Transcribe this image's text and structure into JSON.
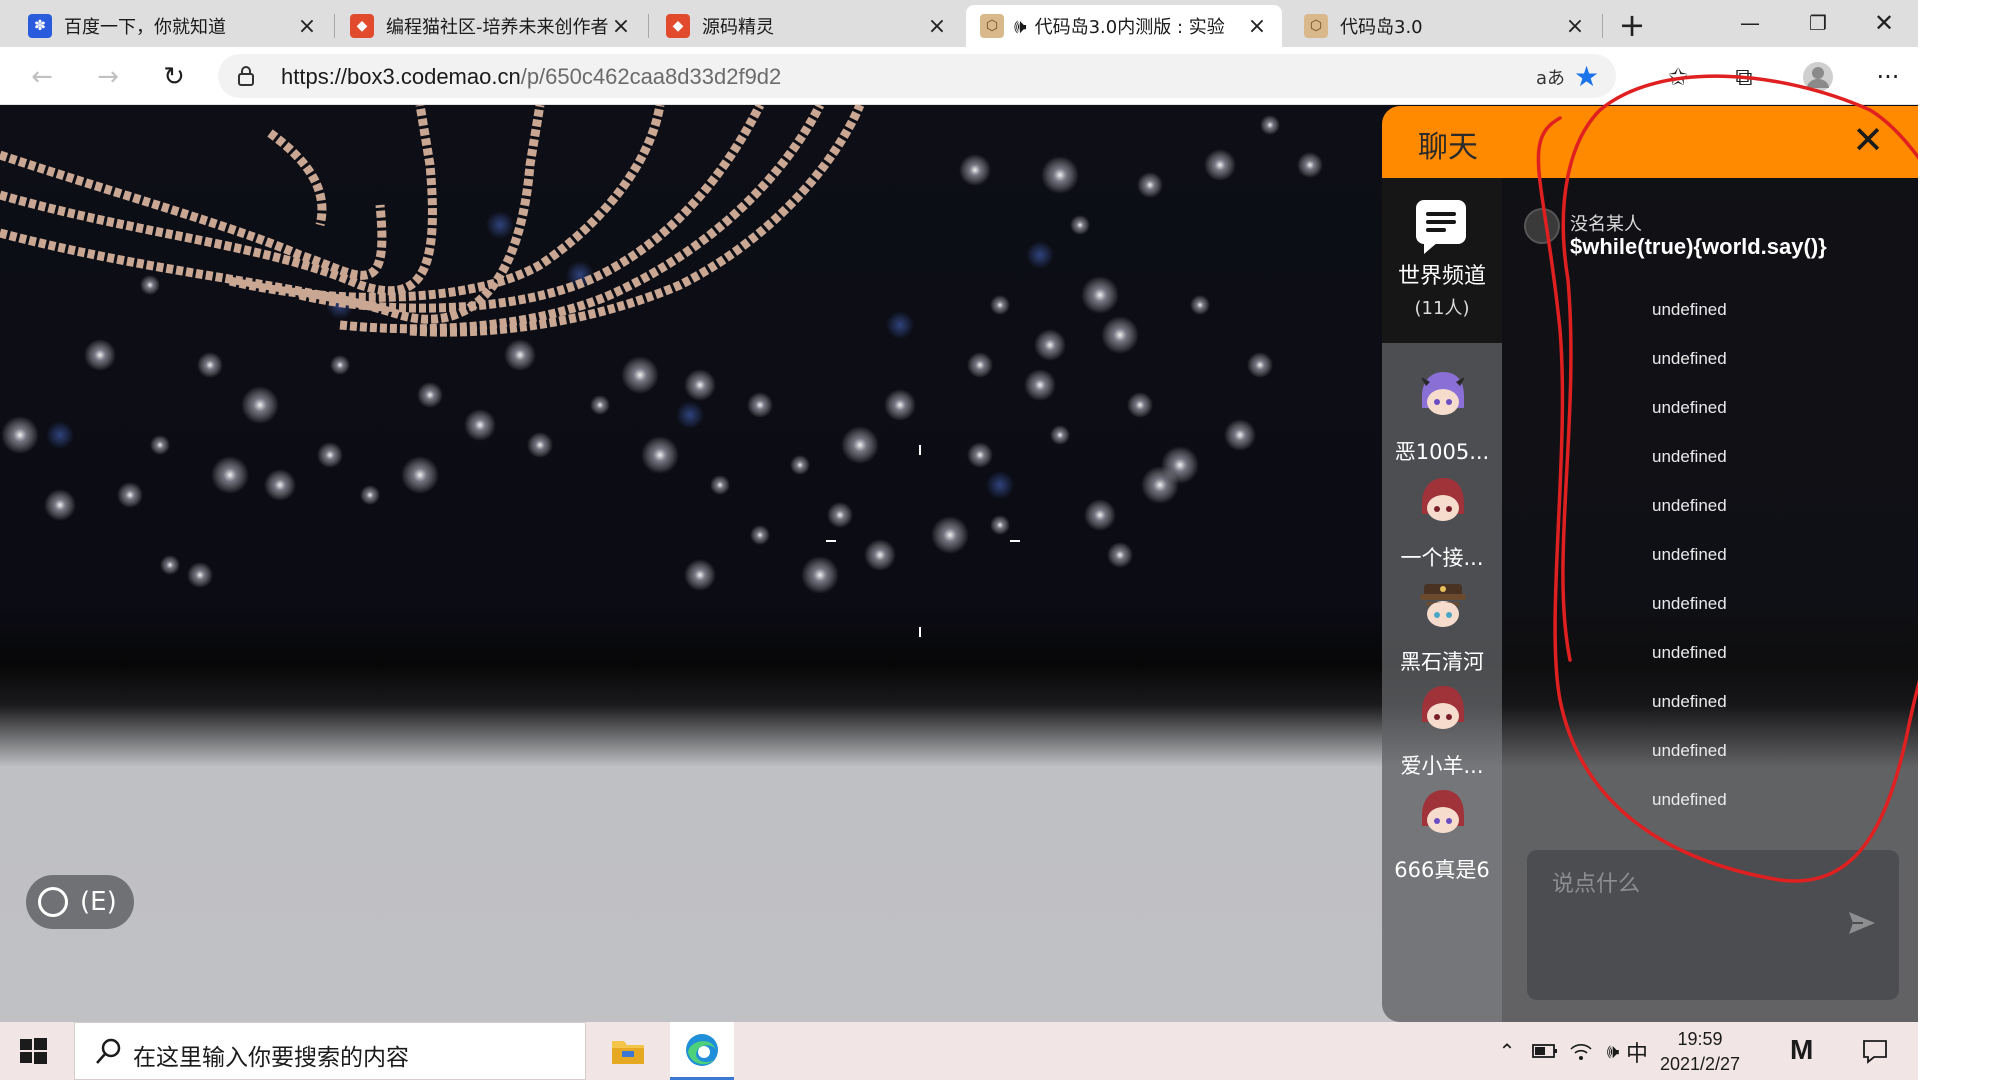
{
  "browser": {
    "tabs": [
      {
        "title": "百度一下，你就知道",
        "favicon": "baidu-paw-icon",
        "active": false
      },
      {
        "title": "编程猫社区-培养未来创作者",
        "favicon": "codemao-cat-icon",
        "active": false
      },
      {
        "title": "源码精灵",
        "favicon": "codemao-cat-icon",
        "active": false
      },
      {
        "title": "代码岛3.0内测版 : 实验",
        "favicon": "box3-cube-icon",
        "active": true,
        "audio": "speaker-icon"
      },
      {
        "title": "代码岛3.0",
        "favicon": "box3-cube-icon",
        "active": false
      }
    ],
    "new_tab": "+",
    "url_host": "https://box3.codemao.cn",
    "url_path": "/p/650c462caa8d33d2f9d2",
    "read_aloud": "aあ",
    "accent_color": "#1a73e8"
  },
  "game": {
    "interact_hint": "(E)"
  },
  "chat": {
    "title": "聊天",
    "header_color": "#ff8a00",
    "world_channel": {
      "name": "世界频道",
      "count": "(11人)"
    },
    "members": [
      {
        "name": "恶1005...",
        "hair": "#8a6fd6"
      },
      {
        "name": "一个接...",
        "hair": "#a0323a"
      },
      {
        "name": "黑石清河",
        "hair": "#6b4a2e"
      },
      {
        "name": "爱小羊...",
        "hair": "#a0323a"
      },
      {
        "name": "666真是6",
        "hair": "#a0323a"
      }
    ],
    "message": {
      "sender": "没名某人",
      "text": "$while(true){world.say()}"
    },
    "system_lines": [
      "undefined",
      "undefined",
      "undefined",
      "undefined",
      "undefined",
      "undefined",
      "undefined",
      "undefined",
      "undefined",
      "undefined",
      "undefined"
    ],
    "input_placeholder": "说点什么"
  },
  "taskbar": {
    "search_placeholder": "在这里输入你要搜索的内容",
    "ime": "中",
    "time": "19:59",
    "date": "2021/2/27"
  }
}
